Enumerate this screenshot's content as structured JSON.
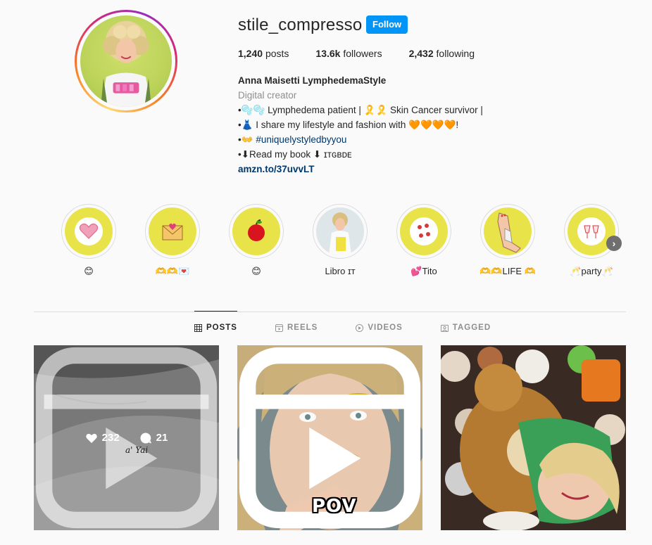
{
  "profile": {
    "username": "stile_compresso",
    "follow_label": "Follow",
    "stats": {
      "posts_count": "1,240",
      "posts_label": "posts",
      "followers_count": "13.6k",
      "followers_label": "followers",
      "following_count": "2,432",
      "following_label": "following"
    },
    "bio": {
      "name": "Anna Maisetti LymphedemaStyle",
      "category": "Digital creator",
      "line1": "•🫧🫧 Lymphedema patient | 🎗️🎗️ Skin Cancer survivor |",
      "line2_prefix": "•👗 I share my lifestyle and fashion with ",
      "line2_suffix": "🧡🧡🧡🧡!",
      "line3_prefix": "•👐",
      "hashtag": "#uniquelystyledbyyou",
      "line4": "•⬇Read my book ⬇ ɪᴛɢʙᴅᴇ",
      "link": "amzn.to/37uvvLT"
    }
  },
  "highlights": [
    {
      "label": "😊",
      "icon": "heart-icon"
    },
    {
      "label": "🫶🫶💌",
      "icon": "envelope-icon"
    },
    {
      "label": "😊",
      "icon": "apple-icon"
    },
    {
      "label": "Libro ɪᴛ",
      "icon": "book-photo"
    },
    {
      "label": "💕Tito",
      "icon": "paw-icon"
    },
    {
      "label": "🫶🫶LIFE 🫶",
      "icon": "leg-icon"
    },
    {
      "label": "🥂party🥂",
      "icon": "glasses-icon"
    }
  ],
  "tabs": [
    {
      "label": "POSTS",
      "icon": "grid-icon",
      "active": true
    },
    {
      "label": "REELS",
      "icon": "reels-icon",
      "active": false
    },
    {
      "label": "VIDEOS",
      "icon": "video-icon",
      "active": false
    },
    {
      "label": "TAGGED",
      "icon": "tag-icon",
      "active": false
    }
  ],
  "posts": [
    {
      "likes": "232",
      "comments": "21",
      "tattoo_text": "a' Yai"
    },
    {
      "caption_text": "POV"
    },
    {}
  ],
  "colors": {
    "follow_button": "#0095f6",
    "link": "#00376b",
    "highlight_bg": "#e9e34a"
  }
}
